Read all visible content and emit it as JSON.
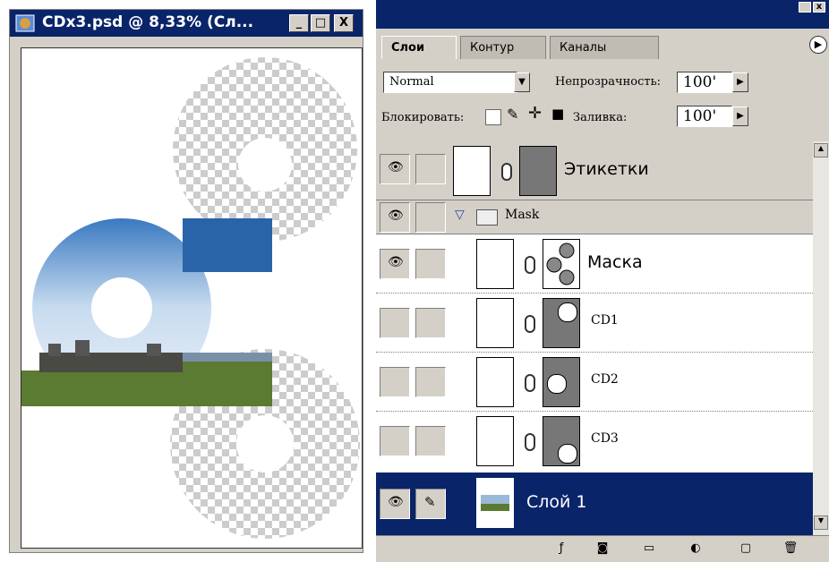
{
  "document": {
    "title": "CDx3.psd @ 8,33% (Сл...",
    "buttons": {
      "minimize": "_",
      "maximize": "□",
      "close": "X"
    }
  },
  "panel": {
    "tabs": [
      {
        "label": "Слои"
      },
      {
        "label": "Контур"
      },
      {
        "label": "Каналы"
      }
    ],
    "blend_mode": "Normal",
    "opacity_label": "Непрозрачность:",
    "opacity_value": "100'",
    "lock_label": "Блокировать:",
    "fill_label": "Заливка:",
    "fill_value": "100'",
    "layers": [
      {
        "name": "Этикетки",
        "visible": true,
        "selected": false
      },
      {
        "name": "Mask",
        "type": "group",
        "visible": true,
        "selected": false
      },
      {
        "name": "Маска",
        "visible": true,
        "selected": false
      },
      {
        "name": "CD1",
        "visible": false,
        "selected": false
      },
      {
        "name": "CD2",
        "visible": false,
        "selected": false
      },
      {
        "name": "CD3",
        "visible": false,
        "selected": false
      },
      {
        "name": "Слой 1",
        "visible": true,
        "selected": true
      }
    ],
    "selected_color": "#0a246a",
    "bottom_icons": [
      "layer-style-icon",
      "add-mask-icon",
      "new-group-icon",
      "adjustment-layer-icon",
      "new-layer-icon",
      "trash-icon"
    ]
  }
}
